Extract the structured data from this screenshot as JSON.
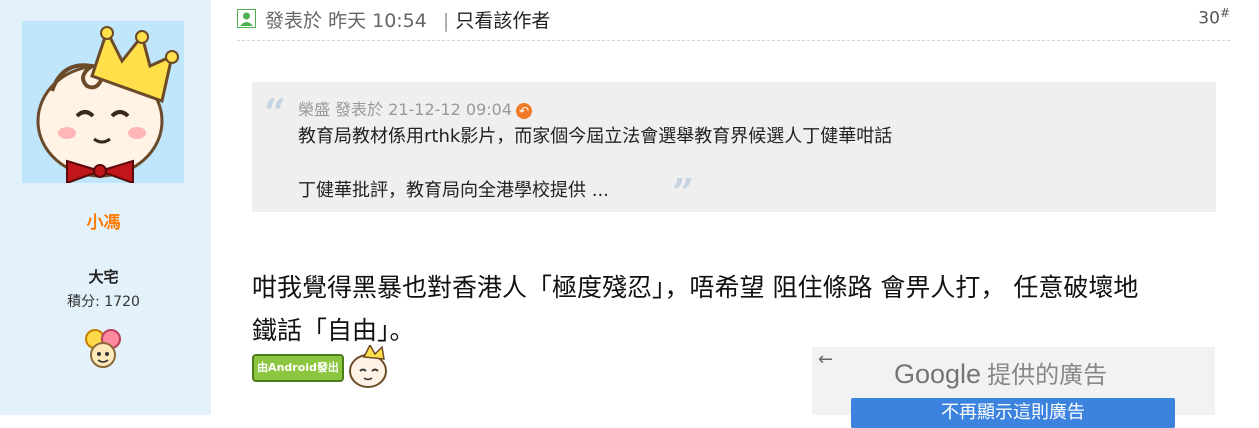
{
  "user": {
    "name": "小馮",
    "rank": "大宅",
    "points": "積分: 1720"
  },
  "post": {
    "posted_label": "發表於",
    "posted_time": "昨天 10:54",
    "separator": "|",
    "author_only": "只看該作者",
    "floor": "30",
    "floor_mark": "#"
  },
  "quote": {
    "meta": "榮盛 發表於 21-12-12 09:04",
    "back_icon": "↶",
    "line1": "教育局教材係用rthk影片，而家個今屆立法會選舉教育界候選人丁健華咁話",
    "line2": "丁健華批評，教育局向全港學校提供 ...",
    "open_mark": "“",
    "close_mark": "”"
  },
  "body": {
    "line1": "咁我覺得黑暴也對香港人「極度殘忍」，唔希望 阻住條路 會畀人打， 任意破壞地",
    "line2": "鐵話「自由」。"
  },
  "badge": {
    "label": "由Android發出"
  },
  "ad": {
    "back": "←",
    "brand": "Google",
    "title": "提供的廣告",
    "button": "不再顯示這則廣告"
  },
  "colors": {
    "sidebar_bg": "#e3f1fb",
    "username": "#ff7a00",
    "quote_bg": "#efefef",
    "ad_button": "#3b83de"
  }
}
